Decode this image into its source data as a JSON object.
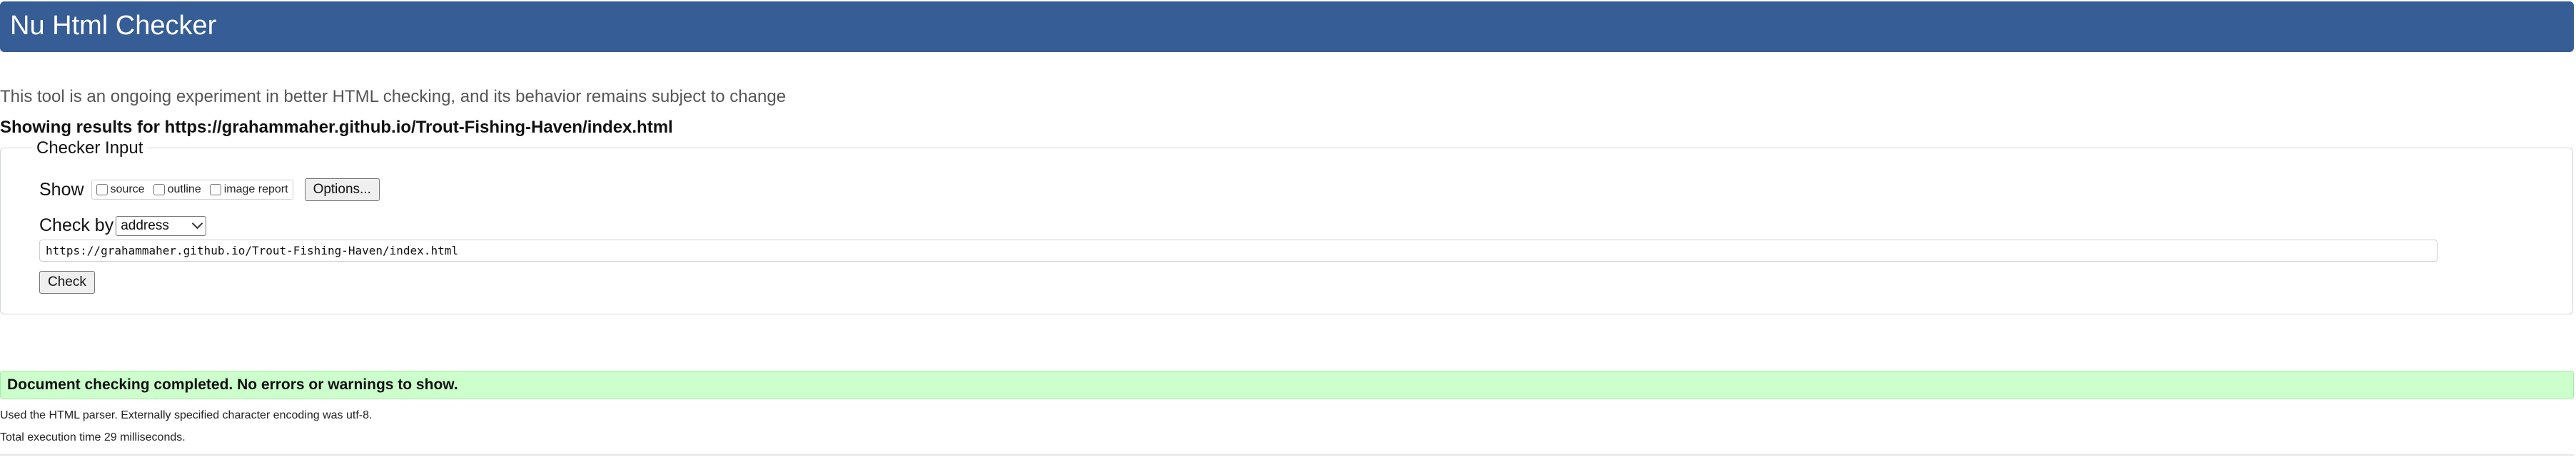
{
  "header": {
    "title": "Nu Html Checker"
  },
  "intro": {
    "text": "This tool is an ongoing experiment in better HTML checking, and its behavior remains subject to change"
  },
  "results": {
    "title": "Showing results for https://grahammaher.github.io/Trout-Fishing-Haven/index.html"
  },
  "checker_input": {
    "legend": "Checker Input",
    "show_label": "Show",
    "options": [
      {
        "label": "source",
        "checked": false
      },
      {
        "label": "outline",
        "checked": false
      },
      {
        "label": "image report",
        "checked": false
      }
    ],
    "options_button": "Options...",
    "check_by_label": "Check by",
    "check_by_selected": "address",
    "url_value": "https://grahammaher.github.io/Trout-Fishing-Haven/index.html",
    "check_button": "Check"
  },
  "status": {
    "message": "Document checking completed. No errors or warnings to show.",
    "details": [
      "Used the HTML parser. Externally specified character encoding was utf-8.",
      "Total execution time 29 milliseconds."
    ]
  },
  "colors": {
    "header": "#365d95",
    "success_background": "#ccffcc",
    "success_border": "#a8e8a8"
  }
}
